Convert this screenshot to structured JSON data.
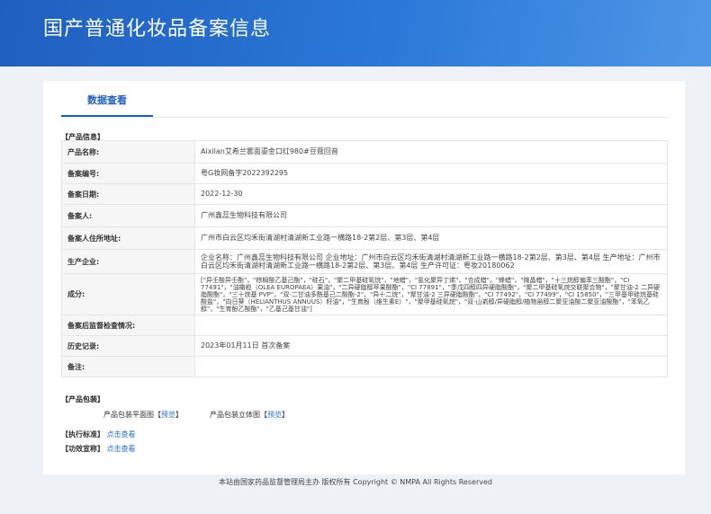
{
  "header": {
    "title": "国产普通化妆品备案信息"
  },
  "tab": {
    "label": "数据查看"
  },
  "product_info": {
    "section_title": "【产品信息】",
    "rows": [
      {
        "key": "产品名称:",
        "value": "Aixilan艾希兰雾面鎏金口红980#豆蔻回音"
      },
      {
        "key": "备案编号:",
        "value": "粤G妆网备字2022392295"
      },
      {
        "key": "备案日期:",
        "value": "2022-12-30"
      },
      {
        "key": "备案人:",
        "value": "广州鑫蕊生物科技有限公司"
      },
      {
        "key": "备案人住所地址:",
        "value": "广州市白云区均禾街清湖村清湖新工业路一横路18-2第2层、第3层、第4层"
      },
      {
        "key": "生产企业:",
        "value": "企业名称：广州鑫蕊生物科技有限公司 企业地址：广州市白云区均禾街清湖村清湖新工业路一横路18-2第2层、第3层、第4层 生产地址：广州市白云区均禾街清湖村清湖新工业路一横路18-2第2层、第3层、第4层 生产许可证：粤妆20180062"
      },
      {
        "key": "成分:",
        "value": "[\"异壬酸异壬酯\"，\"棕榈酸乙基己酯\"，\"硅石\"，\"聚二甲基硅氧烷\"，\"地蜡\"，\"氢化聚异丁烯\"，\"合成蜡\"，\"蜂蜡\"，\"微晶蜡\"，\"十三烷醇偏苯三酸酯\"，\"CI 77491\"，\"油橄榄（OLEA EUROPAEA）果油\"，\"二异硬脂醇苹果酸酯\"，\"CI 77891\"，\"季戊四醇四异硬脂酸酯\"，\"聚二甲基硅氧烷交联聚合物\"，\"聚甘油-2 二异硬脂酸酯\"，\"三十烷基 PVP\"，\"双-二甘油多酰基己二酸酯-2\"，\"异十二烷\"，\"聚甘油-2 三异硬脂酸酯\"，\"CI 77492\"，\"CI 77499\"，\"CI 15850\"，\"三甲基甲硅烷基硅酸盐\"，\"向日葵（HELIANTHUS ANNUUS）籽油\"，\"生育酚（维生素E）\"，\"聚甲基硅氧烷\"，\"双-山嵛醇/异硬脂醇/植物甾醇二聚亚油酸二聚亚油酸酯\"，\"苯氧乙醇\"，\"生育酚乙酸酯\"，\"乙基己基甘油\"]"
      },
      {
        "key": "备案后监督检查情况:",
        "value": ""
      },
      {
        "key": "历史记录:",
        "value": "2023年01月11日 首次备案"
      },
      {
        "key": "备注:",
        "value": ""
      }
    ]
  },
  "packaging": {
    "section_title": "【产品包装】",
    "flat_label": "产品包装平面图",
    "stereo_label": "产品包装立体图",
    "preview_link": "预览",
    "open_bracket": "【",
    "close_bracket": "】"
  },
  "standard": {
    "label": "【执行标准】",
    "link": "点击查看"
  },
  "efficacy": {
    "label": "【功效宣称】",
    "link": "点击查看"
  },
  "footer": {
    "text": "本站由国家药品监督管理局主办 版权所有 Copyright © NMPA All Rights Reserved"
  }
}
